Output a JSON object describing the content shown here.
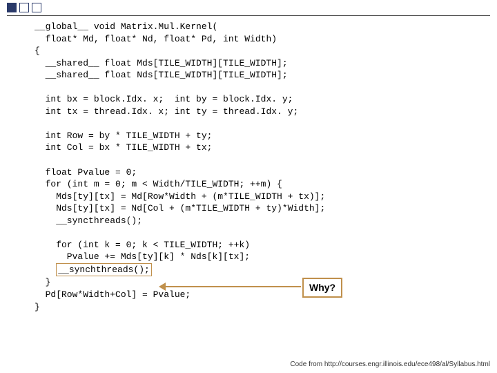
{
  "code": {
    "l01": "__global__ void Matrix.Mul.Kernel(",
    "l02": "  float* Md, float* Nd, float* Pd, int Width)",
    "l03": "{",
    "l04": "  __shared__ float Mds[TILE_WIDTH][TILE_WIDTH];",
    "l05": "  __shared__ float Nds[TILE_WIDTH][TILE_WIDTH];",
    "l06": "",
    "l07": "  int bx = block.Idx. x;  int by = block.Idx. y;",
    "l08": "  int tx = thread.Idx. x; int ty = thread.Idx. y;",
    "l09": "",
    "l10": "  int Row = by * TILE_WIDTH + ty;",
    "l11": "  int Col = bx * TILE_WIDTH + tx;",
    "l12": "",
    "l13": "  float Pvalue = 0;",
    "l14": "  for (int m = 0; m < Width/TILE_WIDTH; ++m) {",
    "l15": "    Mds[ty][tx] = Md[Row*Width + (m*TILE_WIDTH + tx)];",
    "l16": "    Nds[ty][tx] = Nd[Col + (m*TILE_WIDTH + ty)*Width];",
    "l17": "    __syncthreads();",
    "l18": "",
    "l19": "    for (int k = 0; k < TILE_WIDTH; ++k)",
    "l20": "      Pvalue += Mds[ty][k] * Nds[k][tx];",
    "l21_prefix": "    ",
    "l21_box": "__synchthreads();",
    "l22": "  }",
    "l23": "  Pd[Row*Width+Col] = Pvalue;",
    "l24": "}"
  },
  "callout": {
    "label": "Why?"
  },
  "footer": {
    "credit": "Code from http://courses.engr.illinois.edu/ece498/al/Syllabus.html"
  }
}
